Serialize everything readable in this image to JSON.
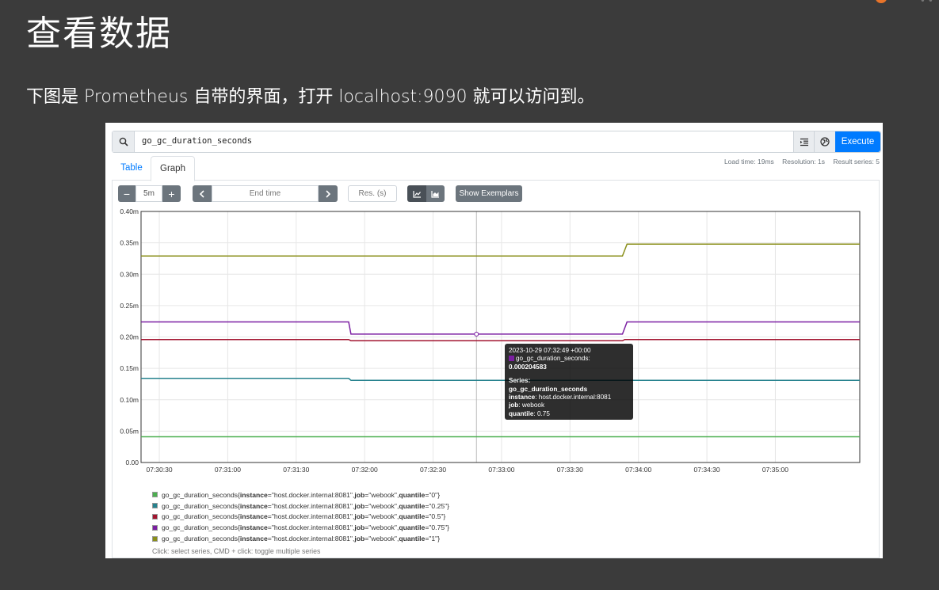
{
  "slide": {
    "title": "查看数据",
    "subtitle": "下图是 Prometheus 自带的界面，打开 localhost:9090 就可以访问到。"
  },
  "query": {
    "expression": "go_gc_duration_seconds",
    "execute_label": "Execute"
  },
  "tabs": [
    {
      "label": "Table",
      "active": false
    },
    {
      "label": "Graph",
      "active": true
    }
  ],
  "stats": {
    "load_time": "Load time: 19ms",
    "resolution": "Resolution: 1s",
    "result_series": "Result series: 5"
  },
  "controls": {
    "minus": "−",
    "range": "5m",
    "plus": "+",
    "end_time_placeholder": "End time",
    "res_placeholder": "Res. (s)",
    "show_exemplars": "Show Exemplars"
  },
  "tooltip": {
    "time": "2023-10-29 07:32:49 +00:00",
    "metric": "go_gc_duration_seconds",
    "value": "0.000204583",
    "series_label": "Series:",
    "series_name": "go_gc_duration_seconds",
    "instance_key": "instance",
    "instance_value": "host.docker.internal:8081",
    "job_key": "job",
    "job_value": "webook",
    "quantile_key": "quantile",
    "quantile_value": "0.75"
  },
  "chart_data": {
    "type": "line",
    "y_ticks": [
      "0.00",
      "0.05m",
      "0.10m",
      "0.15m",
      "0.20m",
      "0.25m",
      "0.30m",
      "0.35m",
      "0.40m"
    ],
    "ylim": [
      0,
      0.0004
    ],
    "x_ticks": [
      "07:30:30",
      "07:31:00",
      "07:31:30",
      "07:32:00",
      "07:32:30",
      "07:33:00",
      "07:33:30",
      "07:34:00",
      "07:34:30",
      "07:35:00"
    ],
    "xlim": [
      "07:30:22",
      "07:35:37"
    ],
    "grid": true,
    "hover_time": "07:32:49",
    "series": [
      {
        "name": "go_gc_duration_seconds{instance=\"host.docker.internal:8081\", job=\"webook\", quantile=\"0\"}",
        "color": "#4caf50",
        "points": [
          [
            "07:30:22",
            4.1e-05
          ],
          [
            "07:35:37",
            4.1e-05
          ]
        ]
      },
      {
        "name": "go_gc_duration_seconds{instance=\"host.docker.internal:8081\", job=\"webook\", quantile=\"0.25\"}",
        "color": "#26828e",
        "points": [
          [
            "07:30:22",
            0.000134
          ],
          [
            "07:31:53",
            0.000134
          ],
          [
            "07:31:54",
            0.000131
          ],
          [
            "07:35:37",
            0.000131
          ]
        ]
      },
      {
        "name": "go_gc_duration_seconds{instance=\"host.docker.internal:8081\", job=\"webook\", quantile=\"0.5\"}",
        "color": "#a2142f",
        "points": [
          [
            "07:30:22",
            0.000196
          ],
          [
            "07:31:53",
            0.000196
          ],
          [
            "07:31:54",
            0.000194
          ],
          [
            "07:33:53",
            0.000194
          ],
          [
            "07:33:54",
            0.000196
          ],
          [
            "07:35:37",
            0.000196
          ]
        ]
      },
      {
        "name": "go_gc_duration_seconds{instance=\"host.docker.internal:8081\", job=\"webook\", quantile=\"0.75\"}",
        "color": "#7b1fa2",
        "points": [
          [
            "07:30:22",
            0.000224
          ],
          [
            "07:31:53",
            0.000224
          ],
          [
            "07:31:54",
            0.0002046
          ],
          [
            "07:33:53",
            0.0002046
          ],
          [
            "07:33:55",
            0.000224
          ],
          [
            "07:35:37",
            0.000224
          ]
        ]
      },
      {
        "name": "go_gc_duration_seconds{instance=\"host.docker.internal:8081\", job=\"webook\", quantile=\"1\"}",
        "color": "#8a8f1a",
        "points": [
          [
            "07:30:22",
            0.000329
          ],
          [
            "07:33:53",
            0.000329
          ],
          [
            "07:33:55",
            0.000348
          ],
          [
            "07:35:37",
            0.000348
          ]
        ]
      }
    ]
  },
  "legend": [
    {
      "metric": "go_gc_duration_seconds{",
      "instance": "host.docker.internal:8081",
      "job": "webook",
      "quantile": "0",
      "color": "#4caf50"
    },
    {
      "metric": "go_gc_duration_seconds{",
      "instance": "host.docker.internal:8081",
      "job": "webook",
      "quantile": "0.25",
      "color": "#26828e"
    },
    {
      "metric": "go_gc_duration_seconds{",
      "instance": "host.docker.internal:8081",
      "job": "webook",
      "quantile": "0.5",
      "color": "#a2142f"
    },
    {
      "metric": "go_gc_duration_seconds{",
      "instance": "host.docker.internal:8081",
      "job": "webook",
      "quantile": "0.75",
      "color": "#7b1fa2"
    },
    {
      "metric": "go_gc_duration_seconds{",
      "instance": "host.docker.internal:8081",
      "job": "webook",
      "quantile": "1",
      "color": "#8a8f1a"
    }
  ],
  "hint": "Click: select series, CMD + click: toggle multiple series"
}
